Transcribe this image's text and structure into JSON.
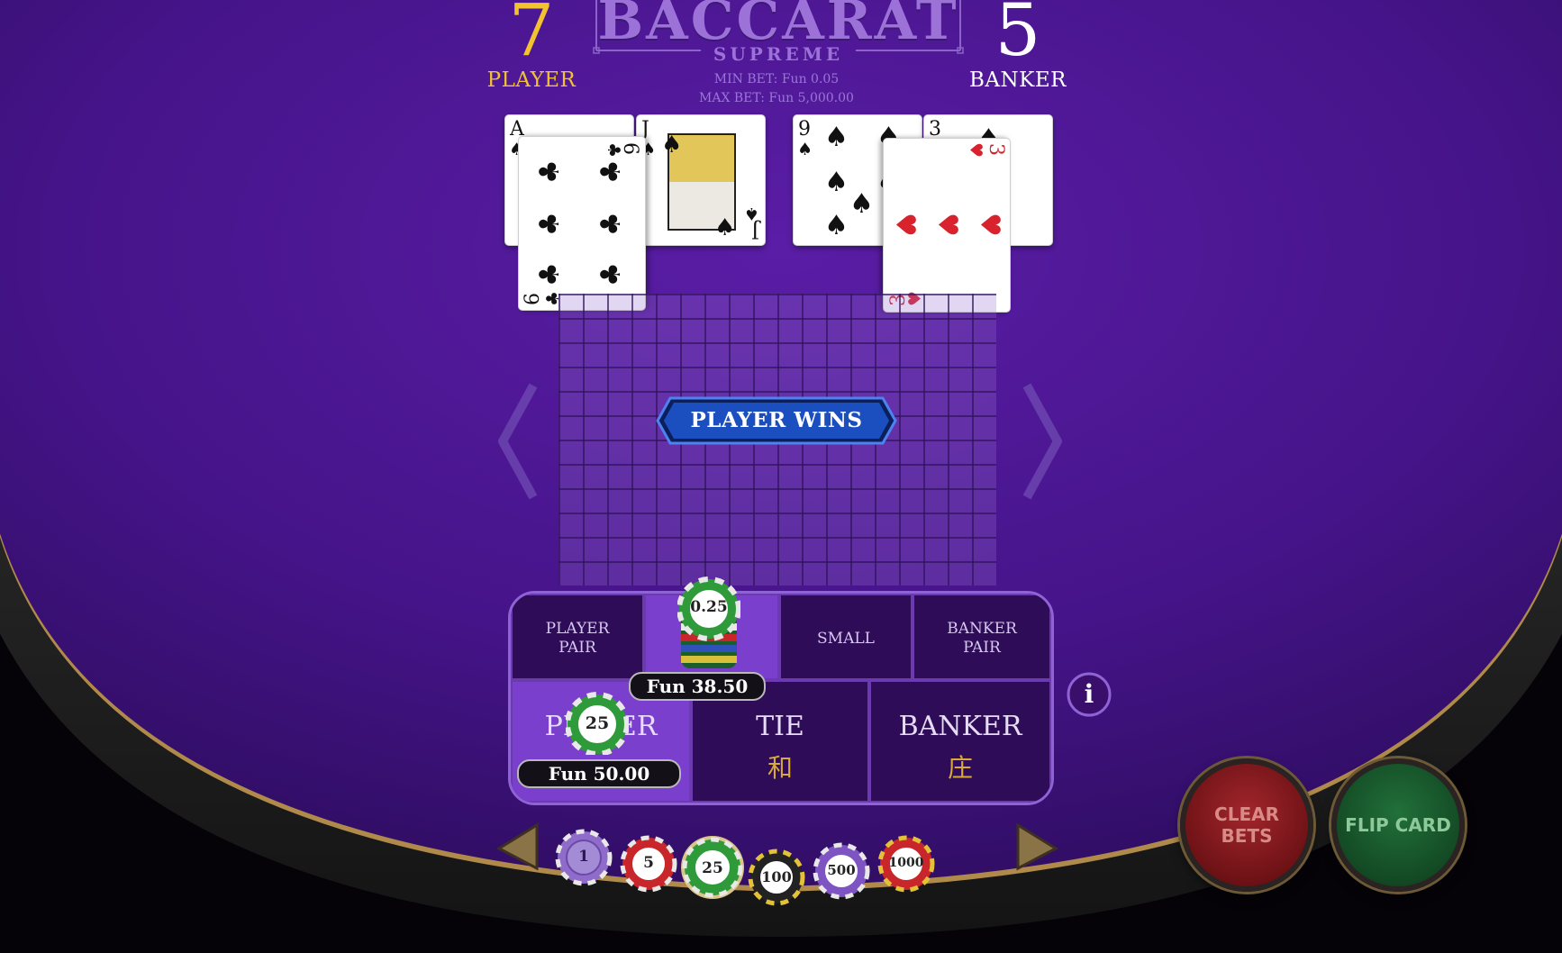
{
  "game": {
    "title": "BACCARAT",
    "subtitle": "SUPREME",
    "min_bet": "MIN BET: Fun 0.05",
    "max_bet": "MAX BET: Fun 5,000.00"
  },
  "scores": {
    "player": {
      "value": "7",
      "label": "PLAYER"
    },
    "banker": {
      "value": "5",
      "label": "BANKER"
    }
  },
  "hands": {
    "player": [
      {
        "rank": "A",
        "suit": "spades"
      },
      {
        "rank": "J",
        "suit": "spades"
      },
      {
        "rank": "6",
        "suit": "clubs"
      }
    ],
    "banker": [
      {
        "rank": "9",
        "suit": "spades"
      },
      {
        "rank": "3",
        "suit": "spades"
      },
      {
        "rank": "3",
        "suit": "hearts"
      }
    ]
  },
  "result": {
    "text": "PLAYER WINS"
  },
  "bet_board": {
    "player_pair": "PLAYER\nPAIR",
    "small": "SMALL",
    "banker_pair": "BANKER\nPAIR",
    "player": "PLAYER",
    "tie": "TIE",
    "tie_cjk": "和",
    "banker": "BANKER",
    "banker_cjk": "庄"
  },
  "placed_bets": {
    "big": {
      "chip": "0.25",
      "amount": "Fun 38.50"
    },
    "player": {
      "chip": "25",
      "amount": "Fun 50.00"
    }
  },
  "controls": {
    "info": "i",
    "clear_bets": "CLEAR BETS",
    "flip_card": "FLIP CARD"
  },
  "chip_tray": [
    {
      "value": "1",
      "color": "#8f6cc9"
    },
    {
      "value": "5",
      "color": "#c8262b"
    },
    {
      "value": "25",
      "color": "#2e9a3a"
    },
    {
      "value": "100",
      "color": "#222222"
    },
    {
      "value": "500",
      "color": "#7d54c2"
    },
    {
      "value": "1000",
      "color": "#c8262b"
    }
  ],
  "colors": {
    "felt": "#4a1690",
    "player_accent": "#f2c230",
    "banner": "#1b4fc0"
  }
}
